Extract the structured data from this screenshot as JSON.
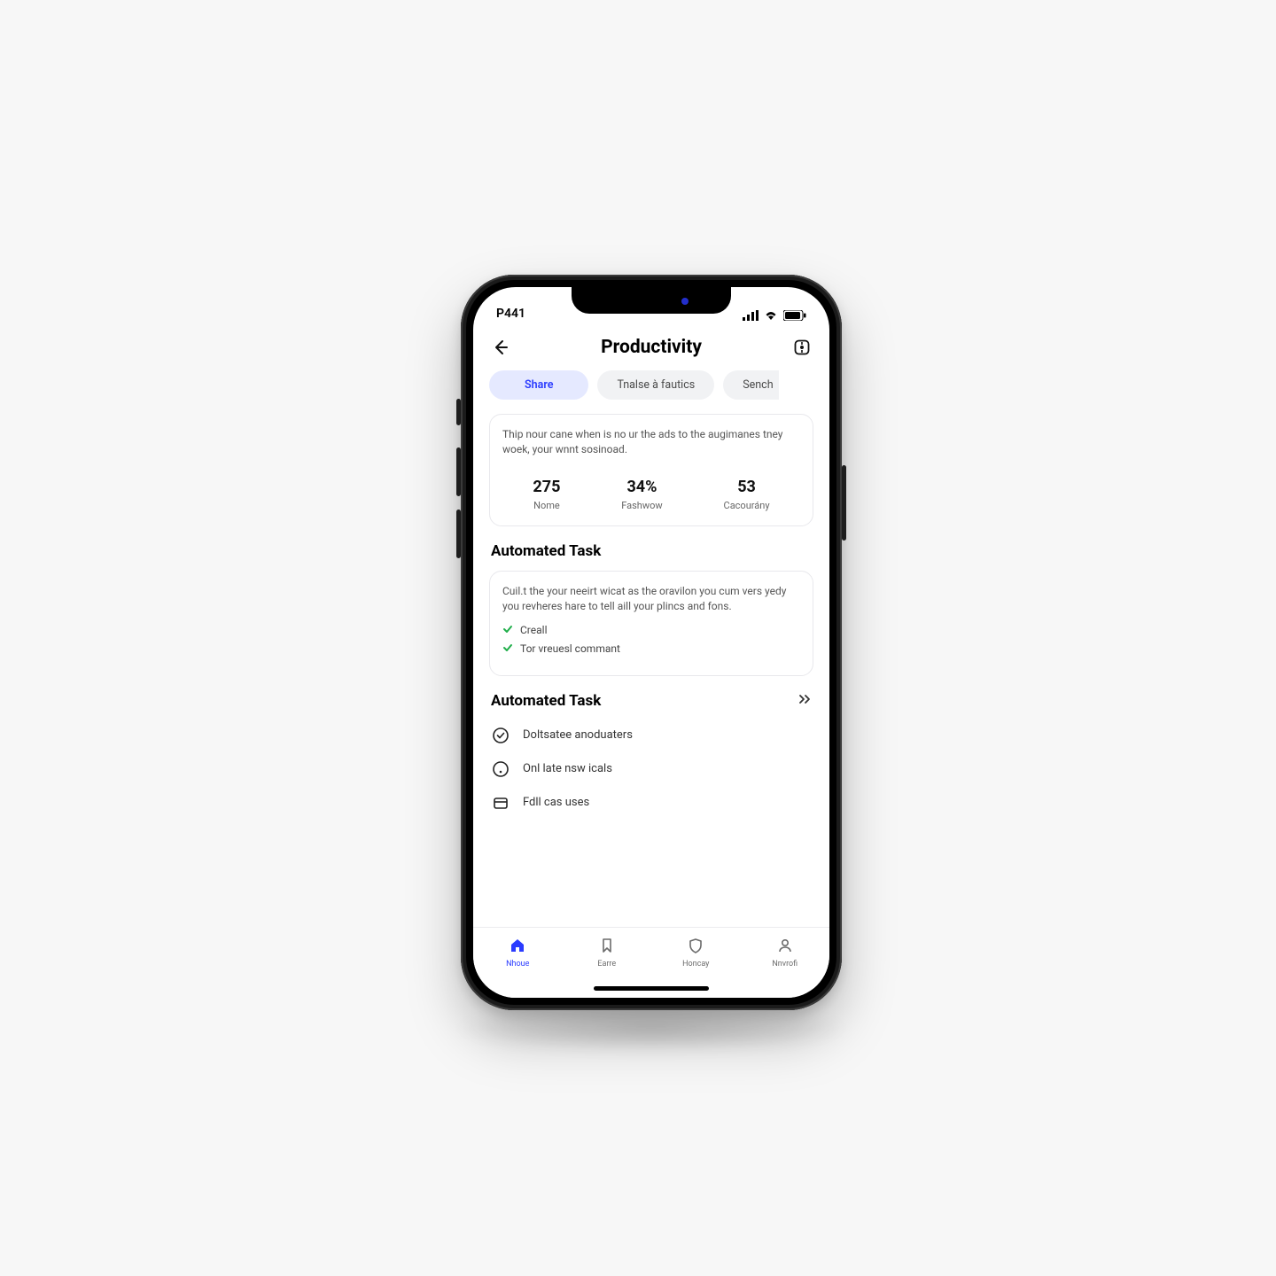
{
  "statusbar": {
    "time": "P441"
  },
  "header": {
    "title": "Productivity"
  },
  "chips": [
    {
      "label": "Share",
      "active": true
    },
    {
      "label": "Tnalse à fautics",
      "active": false
    },
    {
      "label": "Sench",
      "active": false
    }
  ],
  "summary_card": {
    "text": "Thip nour cane when is no ur the ads to the augimanes tney woek, your wnnt sosinoad.",
    "stats": [
      {
        "value": "275",
        "label": "Nome"
      },
      {
        "value": "34%",
        "label": "Fashwow"
      },
      {
        "value": "53",
        "label": "Cacourány"
      }
    ]
  },
  "section1": {
    "title": "Automated Task",
    "text": "Cuil.t the your neeirt wicat as the oravilon you cum vers yedy you revheres hare to tell aill your plincs and fons.",
    "checks": [
      "Creall",
      "Tor vreuesl commant"
    ]
  },
  "section2": {
    "title": "Automated Task",
    "items": [
      {
        "icon": "check-circle",
        "label": "Doltsatee anoduaters"
      },
      {
        "icon": "circle-dot",
        "label": "Onl late nsw icals"
      },
      {
        "icon": "box",
        "label": "Fdll cas uses"
      }
    ]
  },
  "tabs": [
    {
      "icon": "home",
      "label": "Nhoue",
      "active": true
    },
    {
      "icon": "book",
      "label": "Earre",
      "active": false
    },
    {
      "icon": "shield",
      "label": "Honcay",
      "active": false
    },
    {
      "icon": "user",
      "label": "Nnvrofi",
      "active": false
    }
  ]
}
